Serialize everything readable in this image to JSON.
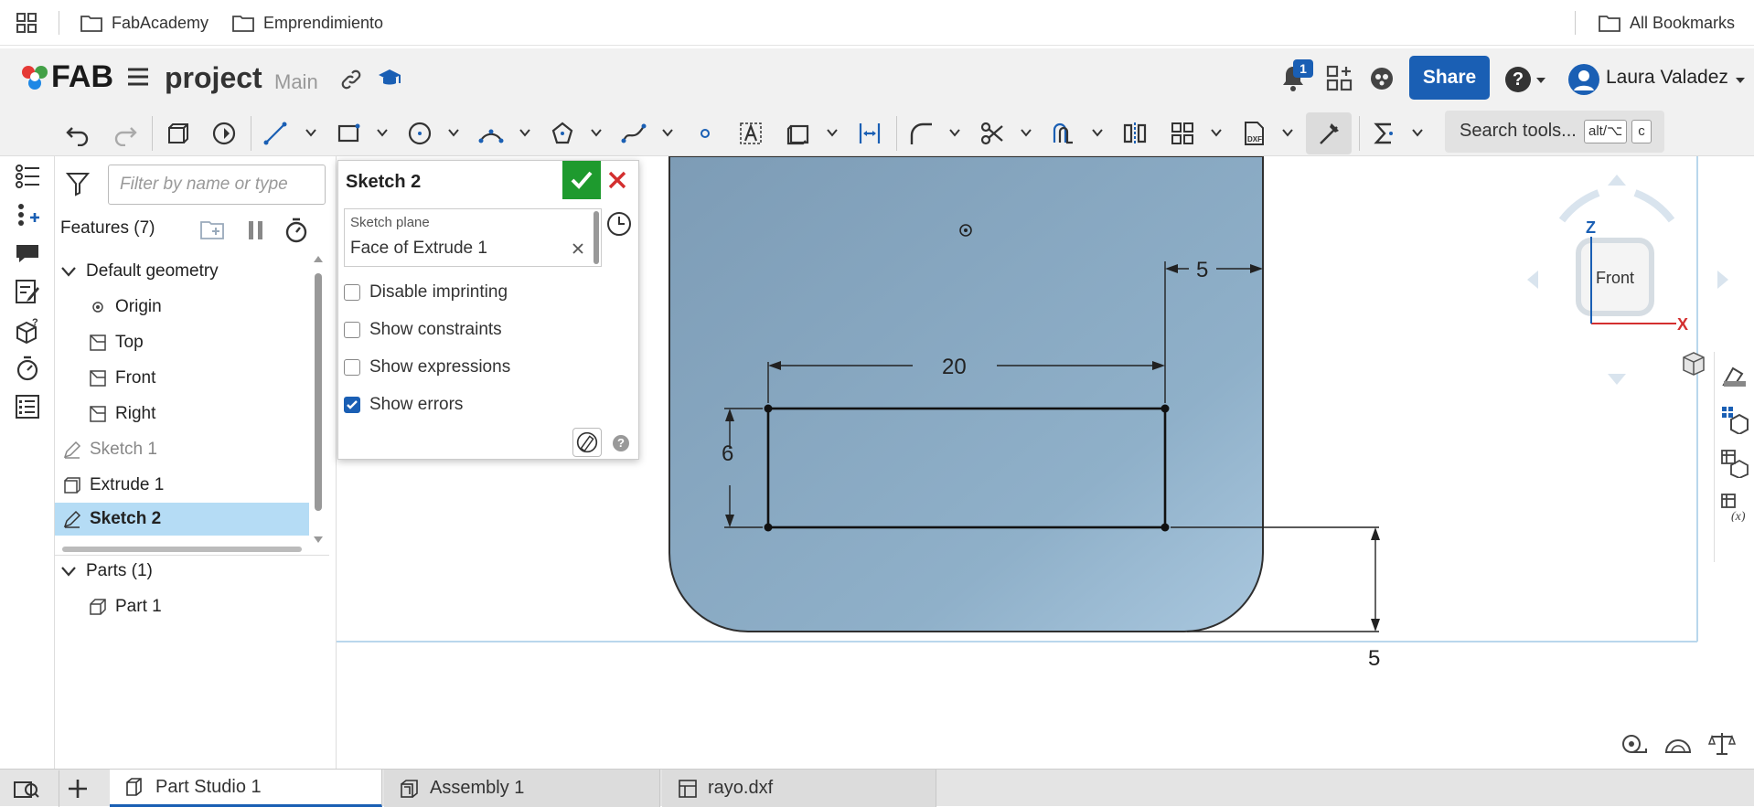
{
  "bookmarks": {
    "items": [
      {
        "label": "FabAcademy"
      },
      {
        "label": "Emprendimiento"
      }
    ],
    "all_label": "All Bookmarks"
  },
  "header": {
    "logo_text": "FAB",
    "doc_name": "project",
    "branch": "Main",
    "notification_count": "1",
    "share_label": "Share",
    "user_name": "Laura Valadez",
    "help_symbol": "?"
  },
  "toolbar": {
    "search_placeholder": "Search tools...",
    "shortcut_keys": [
      "alt/⌥",
      "c"
    ]
  },
  "features": {
    "filter_placeholder": "Filter by name or type",
    "title": "Features (7)",
    "tree": [
      {
        "label": "Default geometry",
        "icon": "chevron-down-icon"
      },
      {
        "label": "Origin",
        "icon": "origin-icon"
      },
      {
        "label": "Top",
        "icon": "plane-icon"
      },
      {
        "label": "Front",
        "icon": "plane-icon"
      },
      {
        "label": "Right",
        "icon": "plane-icon"
      },
      {
        "label": "Sketch 1",
        "icon": "sketch-icon"
      },
      {
        "label": "Extrude 1",
        "icon": "extrude-icon"
      },
      {
        "label": "Sketch 2",
        "icon": "sketch-icon",
        "selected": true
      }
    ],
    "parts_title": "Parts (1)",
    "parts": [
      {
        "label": "Part 1",
        "icon": "part-icon"
      }
    ]
  },
  "sketch_dialog": {
    "title": "Sketch 2",
    "plane_label": "Sketch plane",
    "plane_value": "Face of Extrude 1",
    "options": [
      {
        "label": "Disable imprinting",
        "checked": false
      },
      {
        "label": "Show constraints",
        "checked": false
      },
      {
        "label": "Show expressions",
        "checked": false
      },
      {
        "label": "Show errors",
        "checked": true
      }
    ],
    "help_symbol": "?"
  },
  "viewport": {
    "dimensions": {
      "top_gap": "5",
      "width": "20",
      "height": "6",
      "bottom_gap": "5"
    },
    "view_cube_label": "Front",
    "axis_z": "Z",
    "axis_x": "X"
  },
  "tabs": [
    {
      "label": "Part Studio 1",
      "active": true
    },
    {
      "label": "Assembly 1",
      "active": false
    },
    {
      "label": "rayo.dxf",
      "active": false
    }
  ],
  "colors": {
    "accent": "#1a5fb4",
    "part_fill": "#8aa9c0",
    "confirm": "#1e9a2e",
    "cancel": "#d32f2f",
    "selection": "#b5dcf5"
  }
}
